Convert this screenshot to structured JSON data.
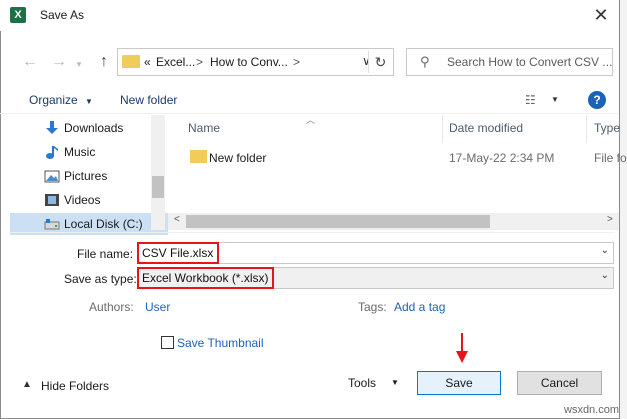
{
  "window": {
    "title": "Save As",
    "app_icon": "X"
  },
  "address_bar": {
    "chevron": "«",
    "crumbs": [
      "Excel...",
      "How to Conv..."
    ],
    "separator": ">",
    "dropdown": "∨"
  },
  "search": {
    "placeholder": "Search How to Convert CSV ..."
  },
  "toolbar": {
    "organize": "Organize",
    "new_folder": "New folder"
  },
  "nav_pane": {
    "items": [
      {
        "label": "Downloads",
        "icon": "download-arrow-icon"
      },
      {
        "label": "Music",
        "icon": "music-note-icon"
      },
      {
        "label": "Pictures",
        "icon": "pictures-icon"
      },
      {
        "label": "Videos",
        "icon": "videos-icon"
      },
      {
        "label": "Local Disk (C:)",
        "icon": "local-disk-icon",
        "selected": true
      }
    ]
  },
  "file_list": {
    "columns": {
      "name": "Name",
      "date_modified": "Date modified",
      "type": "Type"
    },
    "rows": [
      {
        "name": "New folder",
        "date_modified": "17-May-22 2:34 PM",
        "type": "File fo"
      }
    ]
  },
  "form": {
    "file_name_label": "File name:",
    "file_name_value": "CSV File.xlsx",
    "save_as_type_label": "Save as type:",
    "save_as_type_value": "Excel Workbook (*.xlsx)",
    "authors_label": "Authors:",
    "authors_value": "User",
    "tags_label": "Tags:",
    "tags_value": "Add a tag",
    "save_thumbnail_label": "Save Thumbnail"
  },
  "footer": {
    "hide_folders": "Hide Folders",
    "tools": "Tools",
    "save": "Save",
    "cancel": "Cancel"
  },
  "watermark": "wsxdn.com",
  "colors": {
    "highlight": "#e8141c",
    "accent": "#1c63b7"
  }
}
